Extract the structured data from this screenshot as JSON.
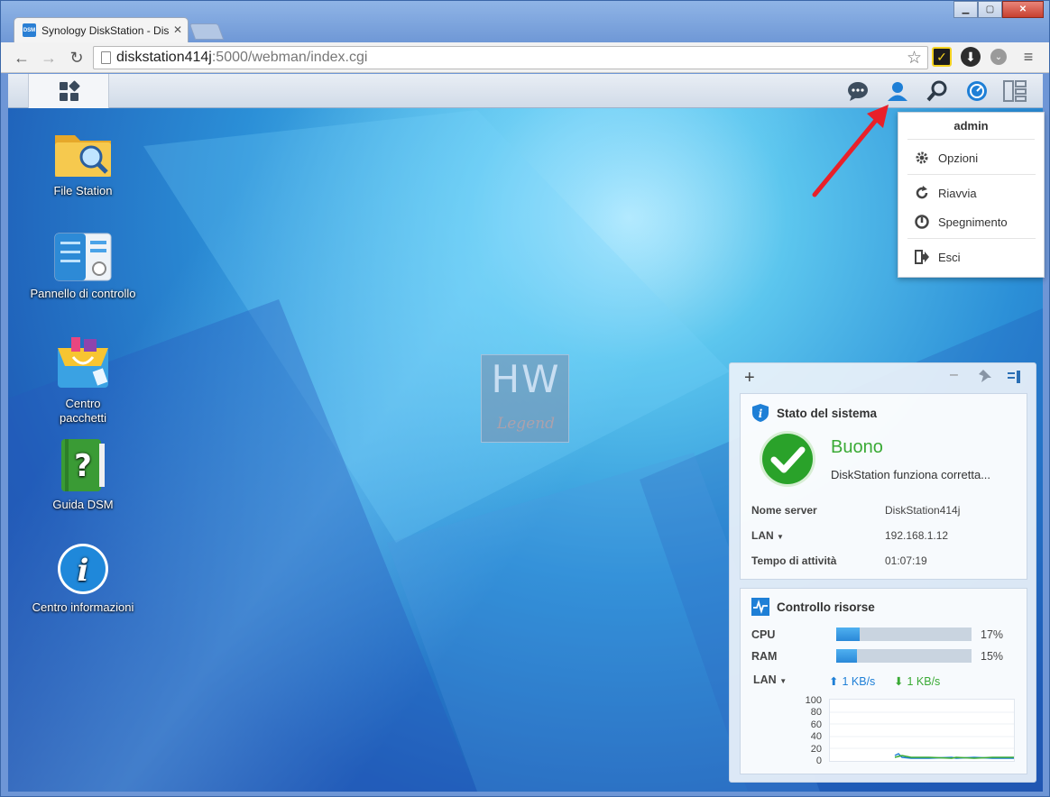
{
  "browser": {
    "tab_title": "Synology DiskStation - Dis",
    "tab_favicon": "DSM",
    "url_host": "diskstation414j",
    "url_path": ":5000/webman/index.cgi"
  },
  "desktop_icons": [
    {
      "label": "File Station"
    },
    {
      "label": "Pannello di controllo"
    },
    {
      "label": "Centro pacchetti"
    },
    {
      "label": "Guida DSM"
    },
    {
      "label": "Centro informazioni"
    }
  ],
  "user_menu": {
    "username": "admin",
    "items": [
      "Opzioni",
      "Riavvia",
      "Spegnimento",
      "Esci"
    ]
  },
  "watermark": {
    "line1": "HW",
    "line2": "Legend"
  },
  "widgets": {
    "system_status": {
      "title": "Stato del sistema",
      "status": "Buono",
      "message": "DiskStation funziona corretta...",
      "rows": [
        {
          "key": "Nome server",
          "value": "DiskStation414j"
        },
        {
          "key": "LAN",
          "value": "192.168.1.12"
        },
        {
          "key": "Tempo di attività",
          "value": "01:07:19"
        }
      ],
      "status_color": "#3aaa35"
    },
    "resource_monitor": {
      "title": "Controllo risorse",
      "cpu_label": "CPU",
      "cpu_percent": 17,
      "cpu_text": "17%",
      "ram_label": "RAM",
      "ram_percent": 15,
      "ram_text": "15%",
      "lan_label": "LAN",
      "upload": "1 KB/s",
      "download": "1 KB/s",
      "chart_y_ticks": [
        "100",
        "80",
        "60",
        "40",
        "20",
        "0"
      ]
    }
  },
  "colors": {
    "accent": "#1e7fd6",
    "annotation_arrow": "#e8202a"
  }
}
